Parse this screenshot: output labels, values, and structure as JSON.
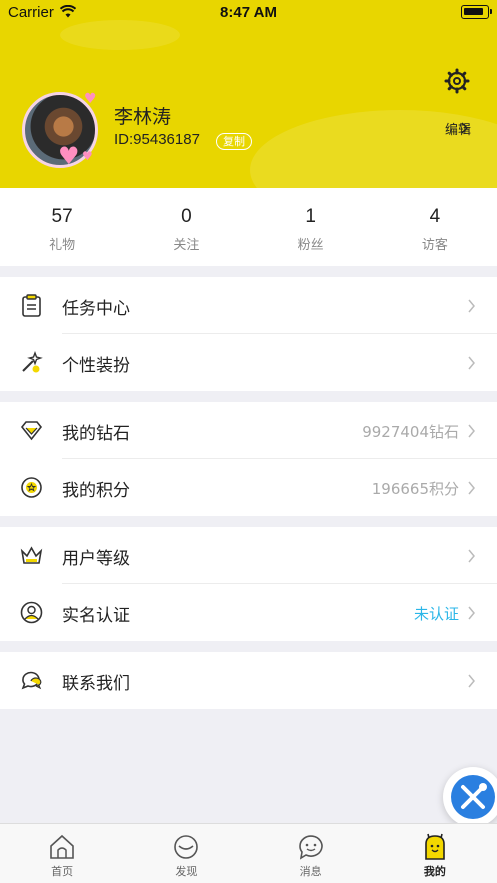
{
  "status_bar": {
    "carrier": "Carrier",
    "time": "8:47 AM"
  },
  "profile": {
    "name": "李林涛",
    "id": "ID:95436187",
    "copy_label": "复制",
    "edit_label": "编辑"
  },
  "stats": [
    {
      "value": "57",
      "label": "礼物"
    },
    {
      "value": "0",
      "label": "关注"
    },
    {
      "value": "1",
      "label": "粉丝"
    },
    {
      "value": "4",
      "label": "访客"
    }
  ],
  "groups": [
    {
      "rows": [
        {
          "label": "任务中心",
          "value": "",
          "icon": "clipboard-icon"
        },
        {
          "label": "个性装扮",
          "value": "",
          "icon": "wand-icon"
        }
      ]
    },
    {
      "rows": [
        {
          "label": "我的钻石",
          "value": "9927404钻石",
          "icon": "diamond-icon"
        },
        {
          "label": "我的积分",
          "value": "196665积分",
          "icon": "points-icon"
        }
      ]
    },
    {
      "rows": [
        {
          "label": "用户等级",
          "value": "",
          "icon": "crown-icon"
        },
        {
          "label": "实名认证",
          "value": "未认证",
          "icon": "verify-icon"
        }
      ]
    },
    {
      "rows": [
        {
          "label": "联系我们",
          "value": "",
          "icon": "chat-icon"
        }
      ]
    }
  ],
  "tabs": [
    {
      "label": "首页",
      "icon": "home-icon"
    },
    {
      "label": "发现",
      "icon": "discover-icon"
    },
    {
      "label": "消息",
      "icon": "message-icon"
    },
    {
      "label": "我的",
      "icon": "me-icon"
    }
  ],
  "colors": {
    "header": "#e8d600",
    "accent_blue": "#2ab6e8"
  }
}
